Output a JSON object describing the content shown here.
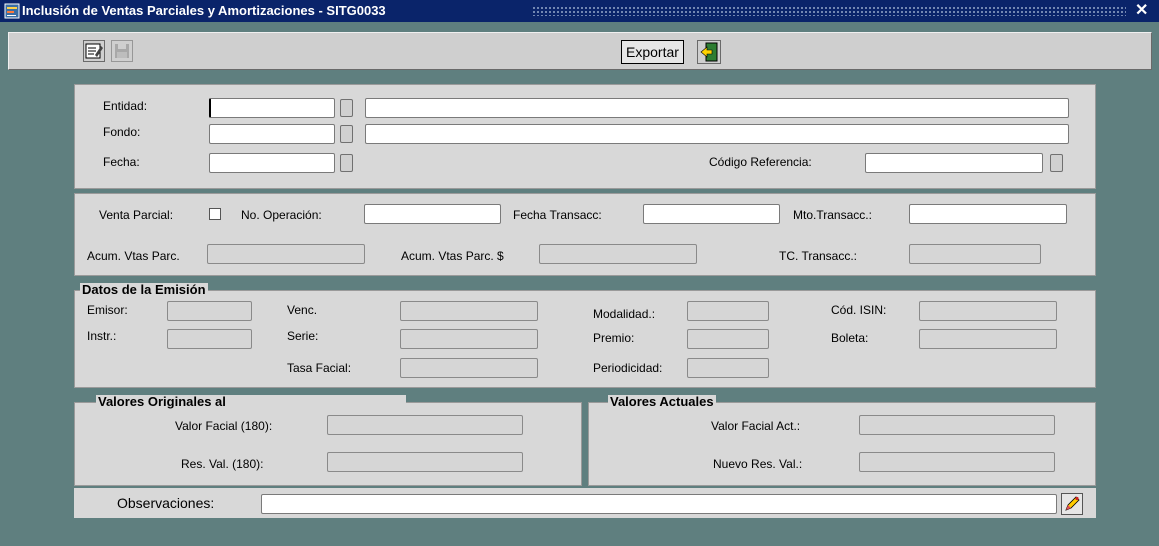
{
  "window": {
    "title": "Inclusión de Ventas Parciales y Amortizaciones - SITG0033",
    "close_glyph": "✕"
  },
  "toolbar": {
    "export_label": "Exportar",
    "icons": [
      "edit-icon",
      "save-icon",
      "exit-icon"
    ]
  },
  "header": {
    "entidad_label": "Entidad:",
    "fondo_label": "Fondo:",
    "fecha_label": "Fecha:",
    "codigo_referencia_label": "Código Referencia:"
  },
  "transaccion": {
    "venta_parcial_label": "Venta Parcial:",
    "no_operacion_label": "No. Operación:",
    "fecha_transacc_label": "Fecha Transacc:",
    "mto_transacc_label": "Mto.Transacc.:",
    "acum_vtas_parc_label": "Acum. Vtas Parc.",
    "acum_vtas_parc_dolar_label": "Acum. Vtas Parc. $",
    "tc_transacc_label": "TC. Transacc.:"
  },
  "emision": {
    "legend": "Datos de la Emisión",
    "emisor_label": "Emisor:",
    "instr_label": "Instr.:",
    "venc_label": "Venc.",
    "serie_label": "Serie:",
    "tasa_facial_label": "Tasa Facial:",
    "modalidad_label": "Modalidad.:",
    "premio_label": "Premio:",
    "periodicidad_label": "Periodicidad:",
    "cod_isin_label": "Cód. ISIN:",
    "boleta_label": "Boleta:"
  },
  "originales": {
    "legend": "Valores Originales al",
    "valor_facial_label": "Valor Facial (180):",
    "res_val_label": "Res. Val. (180):"
  },
  "actuales": {
    "legend": "Valores Actuales",
    "valor_facial_act_label": "Valor Facial Act.:",
    "nuevo_res_val_label": "Nuevo Res. Val.:"
  },
  "observaciones": {
    "label": "Observaciones:"
  },
  "colors": {
    "background": "#5f7f7f",
    "titlebar": "#0a246a",
    "panel": "#d8d8d8"
  }
}
